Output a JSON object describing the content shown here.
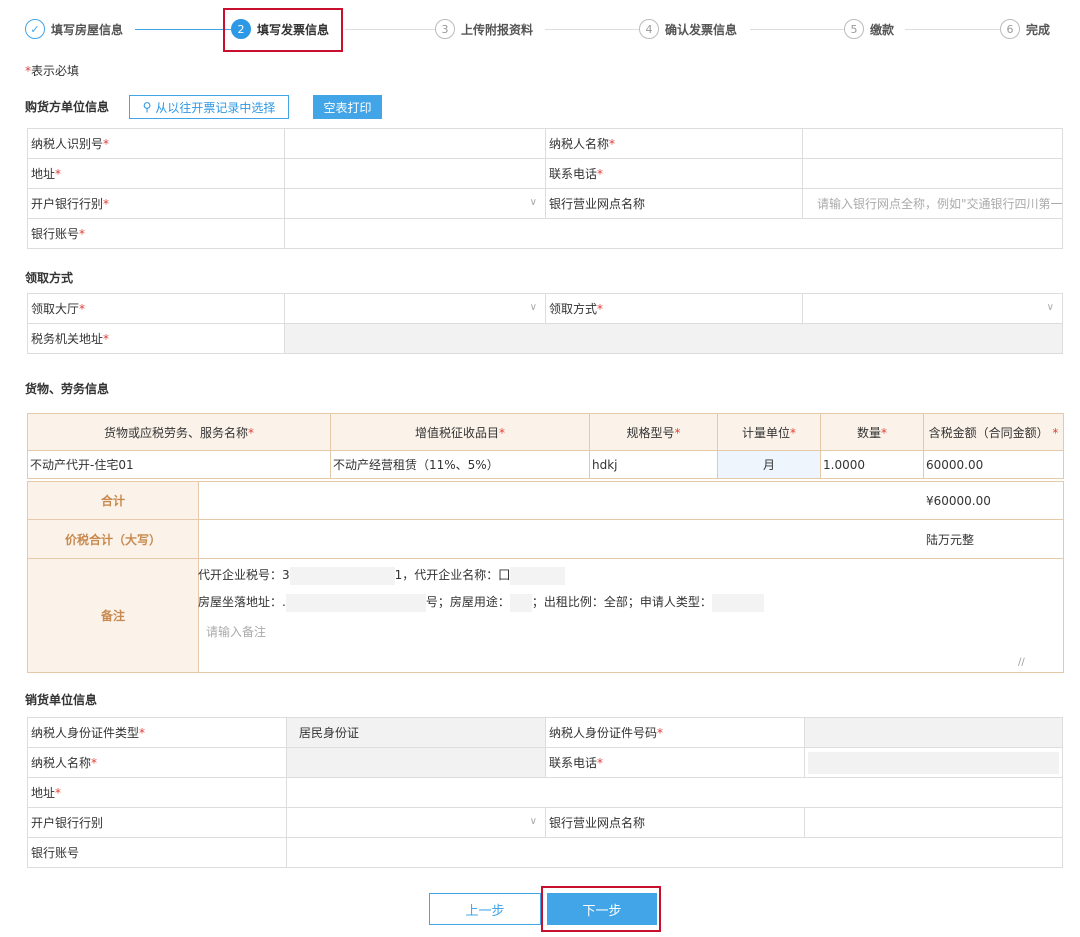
{
  "steps": [
    {
      "num": "✓",
      "label": "填写房屋信息"
    },
    {
      "num": "2",
      "label": "填写发票信息"
    },
    {
      "num": "3",
      "label": "上传附报资料"
    },
    {
      "num": "4",
      "label": "确认发票信息"
    },
    {
      "num": "5",
      "label": "缴款"
    },
    {
      "num": "6",
      "label": "完成"
    }
  ],
  "required_note": "表示必填",
  "buyer": {
    "title": "购货方单位信息",
    "select_history_btn": "从以往开票记录中选择",
    "print_blank_btn": "空表打印",
    "taxpayer_id_label": "纳税人识别号",
    "taxpayer_name_label": "纳税人名称",
    "address_label": "地址",
    "phone_label": "联系电话",
    "bank_type_label": "开户银行行别",
    "bank_branch_label": "银行营业网点名称",
    "bank_branch_placeholder": "请输入银行网点全称，例如\"交通银行四川第一",
    "bank_account_label": "银行账号"
  },
  "pickup": {
    "title": "领取方式",
    "hall_label": "领取大厅",
    "method_label": "领取方式",
    "tax_office_addr_label": "税务机关地址"
  },
  "goods": {
    "title": "货物、劳务信息",
    "headers": [
      "货物或应税劳务、服务名称",
      "增值税征收品目",
      "规格型号",
      "计量单位",
      "数量",
      "含税金额（合同金额）"
    ],
    "row": {
      "name": "不动产代开-住宅01",
      "item": "不动产经营租赁（11%、5%）",
      "spec": "hdkj",
      "unit": "月",
      "qty": "1.0000",
      "amount": "60000.00"
    },
    "total_label": "合计",
    "total_value": "¥60000.00",
    "total_cn_label": "价税合计（大写）",
    "total_cn_value": "陆万元整",
    "memo_label": "备注",
    "memo_line1_a": "代开企业税号：3",
    "memo_line1_b": "1，代开企业名称：囗",
    "memo_line2_a": "房屋坐落地址：.",
    "memo_line2_b": "号；房屋用途：",
    "memo_line2_c": "；出租比例：全部；申请人类型：",
    "memo_placeholder": "请输入备注"
  },
  "seller": {
    "title": "销货单位信息",
    "id_type_label": "纳税人身份证件类型",
    "id_type_value": "居民身份证",
    "id_no_label": "纳税人身份证件号码",
    "name_label": "纳税人名称",
    "phone_label": "联系电话",
    "address_label": "地址",
    "bank_type_label": "开户银行行别",
    "bank_branch_label": "银行营业网点名称",
    "bank_account_label": "银行账号"
  },
  "footer": {
    "prev_label": "上一步",
    "next_label": "下一步"
  }
}
